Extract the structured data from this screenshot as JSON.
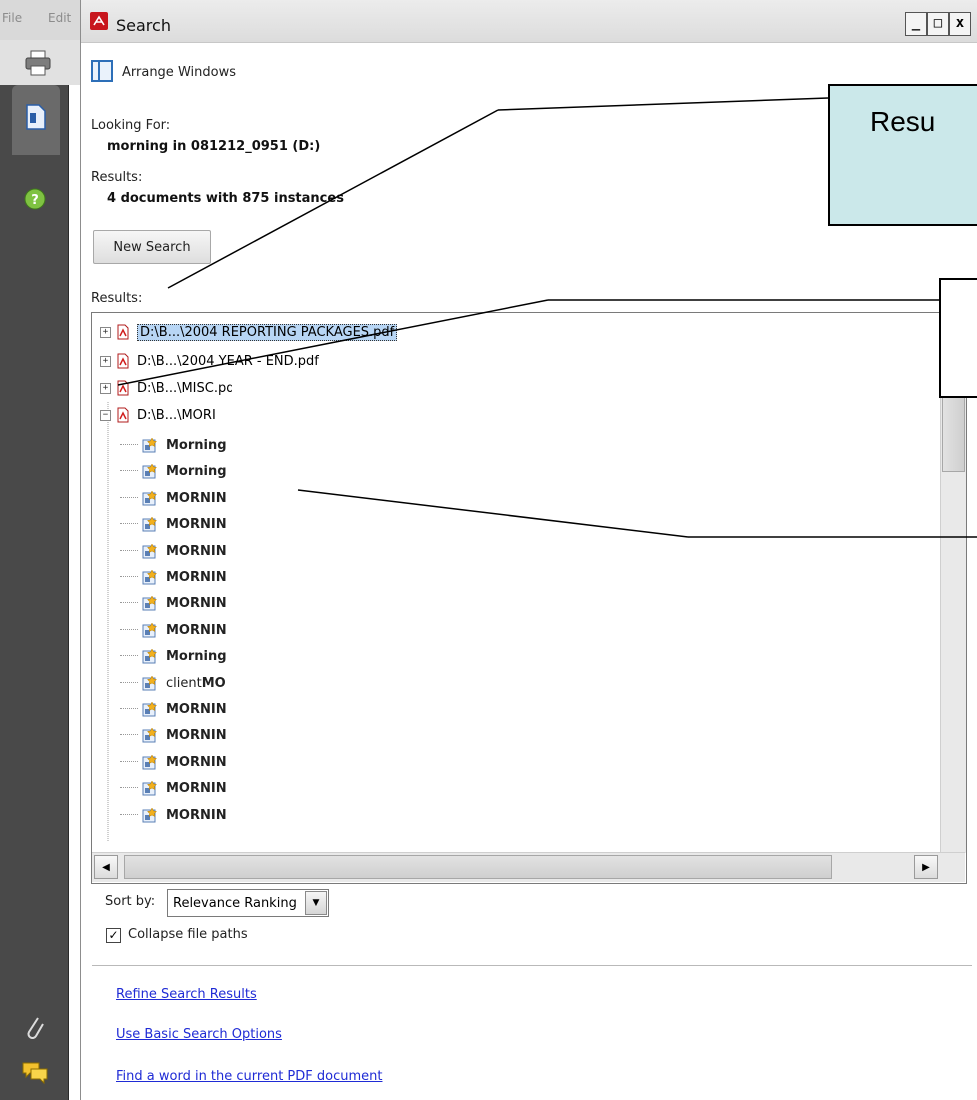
{
  "host_app": {
    "menu": [
      "File",
      "Edit"
    ]
  },
  "window": {
    "title": "Search",
    "controls": [
      "_",
      "□",
      "x"
    ]
  },
  "toolbar": {
    "arrange_label": "Arrange Windows"
  },
  "query": {
    "looking_for_label": "Looking For:",
    "looking_for_value": "morning in 081212_0951 (D:)",
    "results_label": "Results:",
    "results_value": "4 documents with 875 instances"
  },
  "new_search_label": "New Search",
  "results_tree_label": "Results:",
  "documents": [
    {
      "path": "D:\\B...\\2004 REPORTING PACKAGES.pdf",
      "expanded": false,
      "selected": true
    },
    {
      "path": "D:\\B...\\2004 YEAR - END.pdf",
      "expanded": false,
      "selected": false
    },
    {
      "path": "D:\\B...\\MISC.pdf",
      "expanded": false,
      "selected": false
    },
    {
      "path": "D:\\B...\\MORI",
      "expanded": true,
      "selected": false
    }
  ],
  "hits": [
    {
      "text": "Morning",
      "bold": true
    },
    {
      "text": "Morning",
      "bold": true
    },
    {
      "text": "MORNIN",
      "bold": true
    },
    {
      "text": "MORNIN",
      "bold": true
    },
    {
      "text": "MORNIN",
      "bold": true
    },
    {
      "text": "MORNIN",
      "bold": true
    },
    {
      "text": "MORNIN",
      "bold": true
    },
    {
      "text": "MORNIN",
      "bold": true
    },
    {
      "text": "Morning",
      "bold": true
    },
    {
      "text_plain": "client ",
      "text": "MO",
      "bold": true
    },
    {
      "text": "MORNIN",
      "bold": true
    },
    {
      "text": "MORNIN",
      "bold": true
    },
    {
      "text": "MORNIN",
      "bold": true
    },
    {
      "text": "MORNIN",
      "bold": true
    },
    {
      "text": "MORNIN",
      "bold": true
    }
  ],
  "sort": {
    "label": "Sort by:",
    "value": "Relevance Ranking"
  },
  "collapse": {
    "label": "Collapse file paths",
    "checked": true
  },
  "links": {
    "refine": "Refine Search Results",
    "basic": "Use Basic Search Options",
    "find": "Find a word in the current PDF document"
  },
  "annotation": {
    "callout1_text": "Resu"
  },
  "colors": {
    "link": "#1f2bd5",
    "callout_fill": "#cbe8ea",
    "selection": "#b8d6f5",
    "nav_bg": "#494949"
  }
}
